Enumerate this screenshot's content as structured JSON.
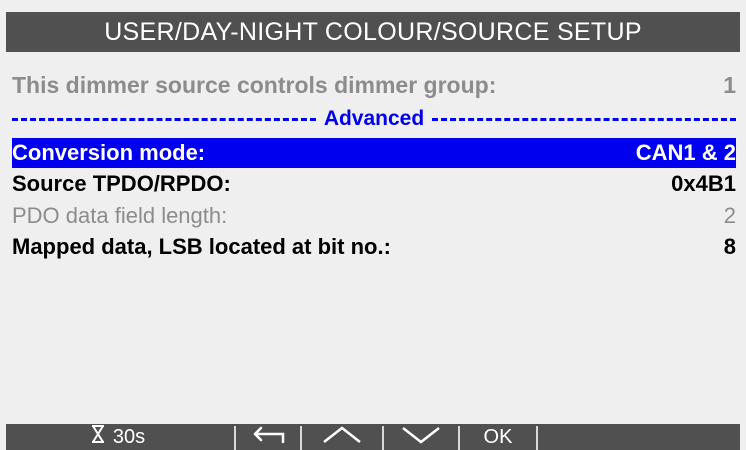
{
  "header": {
    "title": "USER/DAY-NIGHT COLOUR/SOURCE SETUP"
  },
  "rows": [
    {
      "label": "This dimmer source controls dimmer group:",
      "value": "1"
    },
    {
      "label": "Conversion mode:",
      "value": "CAN1 & 2"
    },
    {
      "label": "Source TPDO/RPDO:",
      "value": "0x4B1"
    },
    {
      "label": "PDO data field length:",
      "value": "2"
    },
    {
      "label": "Mapped data, LSB located at bit no.:",
      "value": "8"
    }
  ],
  "divider": {
    "label": "Advanced"
  },
  "softkeys": {
    "timer_icon": "hourglass-icon",
    "timer_label": "30s",
    "back_icon": "return-arrow-icon",
    "up_icon": "chevron-up-icon",
    "down_icon": "chevron-down-icon",
    "ok_label": "OK"
  },
  "colors": {
    "title_bar": "#505050",
    "selection": "#0000ee",
    "disabled_text": "#8c8c8c",
    "background": "#efefef"
  }
}
